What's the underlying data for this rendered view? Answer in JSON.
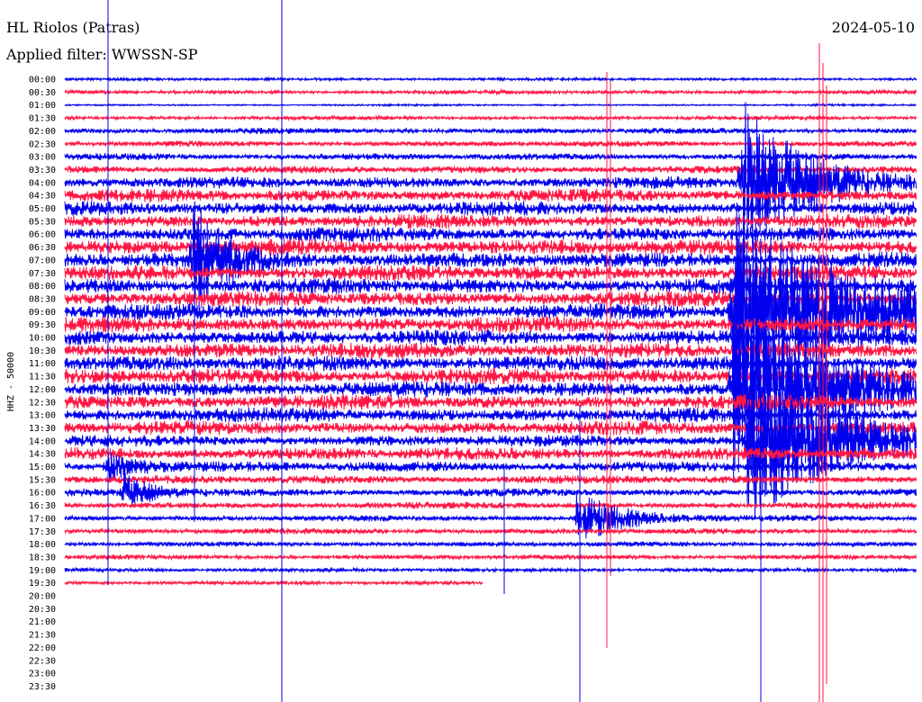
{
  "chart_data": {
    "type": "line",
    "title": "HL Riolos (Patras)",
    "subtitle": "Applied filter: WWSSN-SP",
    "date": "2024-05-10",
    "ylabel": "HHZ - 50000",
    "row_labels": [
      "00:00",
      "00:30",
      "01:00",
      "01:30",
      "02:00",
      "02:30",
      "03:00",
      "03:30",
      "04:00",
      "04:30",
      "05:00",
      "05:30",
      "06:00",
      "06:30",
      "07:00",
      "07:30",
      "08:00",
      "08:30",
      "09:00",
      "09:30",
      "10:00",
      "10:30",
      "11:00",
      "11:30",
      "12:00",
      "12:30",
      "13:00",
      "13:30",
      "14:00",
      "14:30",
      "15:00",
      "15:30",
      "16:00",
      "16:30",
      "17:00",
      "17:30",
      "18:00",
      "18:30",
      "19:00",
      "19:30",
      "20:00",
      "20:30",
      "21:00",
      "21:30",
      "22:00",
      "22:30",
      "23:00",
      "23:30"
    ],
    "trace_colors": [
      "#0000ee",
      "#ff1744"
    ],
    "recorded_until": "19:30",
    "traces": [
      {
        "amp": 1.5
      },
      {
        "amp": 2.0
      },
      {
        "amp": 1.0
      },
      {
        "amp": 2.0
      },
      {
        "amp": 3.0
      },
      {
        "amp": 3.0
      },
      {
        "amp": 3.5
      },
      {
        "amp": 4.0
      },
      {
        "amp": 6.0
      },
      {
        "amp": 6.5
      },
      {
        "amp": 7.0
      },
      {
        "amp": 7.0
      },
      {
        "amp": 7.5
      },
      {
        "amp": 8.0
      },
      {
        "amp": 8.0
      },
      {
        "amp": 8.0
      },
      {
        "amp": 8.0
      },
      {
        "amp": 8.0
      },
      {
        "amp": 8.0
      },
      {
        "amp": 8.0
      },
      {
        "amp": 8.0
      },
      {
        "amp": 8.0
      },
      {
        "amp": 8.0
      },
      {
        "amp": 8.0
      },
      {
        "amp": 8.0
      },
      {
        "amp": 7.5
      },
      {
        "amp": 7.5
      },
      {
        "amp": 7.0
      },
      {
        "amp": 6.0
      },
      {
        "amp": 6.5
      },
      {
        "amp": 5.5
      },
      {
        "amp": 4.5
      },
      {
        "amp": 4.0
      },
      {
        "amp": 3.5
      },
      {
        "amp": 3.0
      },
      {
        "amp": 3.0
      },
      {
        "amp": 2.5
      },
      {
        "amp": 2.5
      },
      {
        "amp": 2.0
      },
      {
        "amp": 2.0
      }
    ],
    "events": [
      {
        "row": 18,
        "minute": 23.5,
        "amp": 120,
        "decay_min": 4
      },
      {
        "row": 24,
        "minute": 23.5,
        "amp": 110,
        "decay_min": 3
      },
      {
        "row": 28,
        "minute": 24.0,
        "amp": 90,
        "decay_min": 3
      },
      {
        "row": 8,
        "minute": 23.8,
        "amp": 95,
        "decay_min": 2
      },
      {
        "row": 14,
        "minute": 4.5,
        "amp": 70,
        "decay_min": 1
      },
      {
        "row": 34,
        "minute": 18.0,
        "amp": 30,
        "decay_min": 1.5
      },
      {
        "row": 32,
        "minute": 2.0,
        "amp": 20,
        "decay_min": 1
      },
      {
        "row": 30,
        "minute": 1.5,
        "amp": 15,
        "decay_min": 1
      }
    ]
  }
}
